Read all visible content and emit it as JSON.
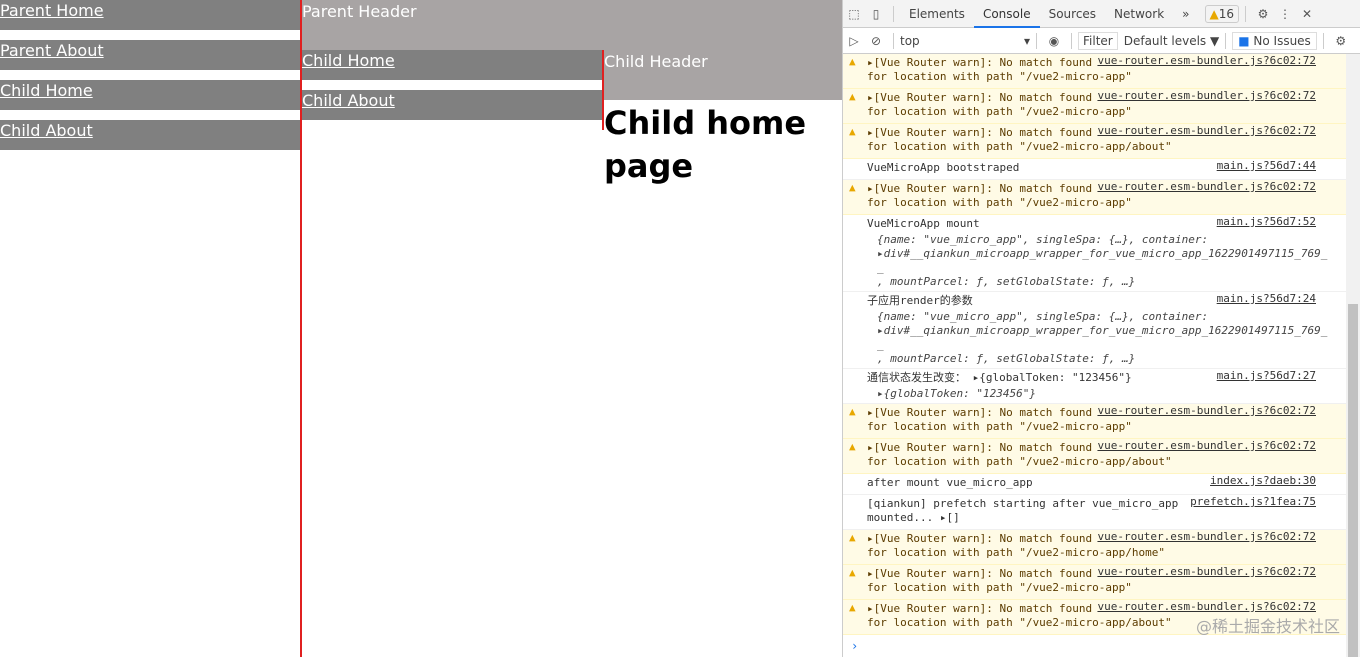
{
  "parent": {
    "nav": [
      "Parent Home",
      "Parent About",
      "Child Home",
      "Child About"
    ],
    "header": "Parent Header"
  },
  "child": {
    "nav": [
      "Child Home",
      "Child About"
    ],
    "header": "Child Header",
    "title": "Child home page"
  },
  "devtools": {
    "tabs": [
      "Elements",
      "Console",
      "Sources",
      "Network"
    ],
    "more": "»",
    "warn_count": "16",
    "context": "top",
    "filter": "Filter",
    "levels": "Default levels ▼",
    "issues": "No Issues",
    "messages": [
      {
        "type": "warn",
        "text": "▸[Vue Router warn]: No match found for location with path \"/vue2-micro-app\"",
        "src": "vue-router.esm-bundler.js?6c02:72"
      },
      {
        "type": "warn",
        "text": "▸[Vue Router warn]: No match found for location with path \"/vue2-micro-app\"",
        "src": "vue-router.esm-bundler.js?6c02:72"
      },
      {
        "type": "warn",
        "text": "▸[Vue Router warn]: No match found for location with path \"/vue2-micro-app/about\"",
        "src": "vue-router.esm-bundler.js?6c02:72"
      },
      {
        "type": "info",
        "text": "VueMicroApp bootstraped",
        "src": "main.js?56d7:44"
      },
      {
        "type": "warn",
        "text": "▸[Vue Router warn]: No match found for location with path \"/vue2-micro-app\"",
        "src": "vue-router.esm-bundler.js?6c02:72"
      },
      {
        "type": "info",
        "text": "VueMicroApp mount",
        "src": "main.js?56d7:52",
        "obj": [
          "{name: \"vue_micro_app\", singleSpa: {…}, container:",
          "▸div#__qiankun_microapp_wrapper_for_vue_micro_app_1622901497115_769_",
          "_",
          ", mountParcel: ƒ, setGlobalState: ƒ, …}"
        ]
      },
      {
        "type": "info",
        "text": "子应用render的参数",
        "src": "main.js?56d7:24",
        "obj": [
          "{name: \"vue_micro_app\", singleSpa: {…}, container:",
          "▸div#__qiankun_microapp_wrapper_for_vue_micro_app_1622901497115_769_",
          "_",
          ", mountParcel: ƒ, setGlobalState: ƒ, …}"
        ]
      },
      {
        "type": "info",
        "text": "通信状态发生改变：  ▸{globalToken: \"123456\"}",
        "src": "main.js?56d7:27",
        "obj": [
          "▸{globalToken: \"123456\"}"
        ]
      },
      {
        "type": "warn",
        "text": "▸[Vue Router warn]: No match found for location with path \"/vue2-micro-app\"",
        "src": "vue-router.esm-bundler.js?6c02:72"
      },
      {
        "type": "warn",
        "text": "▸[Vue Router warn]: No match found for location with path \"/vue2-micro-app/about\"",
        "src": "vue-router.esm-bundler.js?6c02:72"
      },
      {
        "type": "info",
        "text": "after mount vue_micro_app",
        "src": "index.js?daeb:30"
      },
      {
        "type": "info",
        "text": "[qiankun] prefetch starting after vue_micro_app mounted... ▸[]",
        "src": "prefetch.js?1fea:75"
      },
      {
        "type": "warn",
        "text": "▸[Vue Router warn]: No match found for location with path \"/vue2-micro-app/home\"",
        "src": "vue-router.esm-bundler.js?6c02:72"
      },
      {
        "type": "warn",
        "text": "▸[Vue Router warn]: No match found for location with path \"/vue2-micro-app\"",
        "src": "vue-router.esm-bundler.js?6c02:72"
      },
      {
        "type": "warn",
        "text": "▸[Vue Router warn]: No match found for location with path \"/vue2-micro-app/about\"",
        "src": "vue-router.esm-bundler.js?6c02:72"
      }
    ],
    "prompt": "›",
    "watermark": "@稀土掘金技术社区"
  }
}
